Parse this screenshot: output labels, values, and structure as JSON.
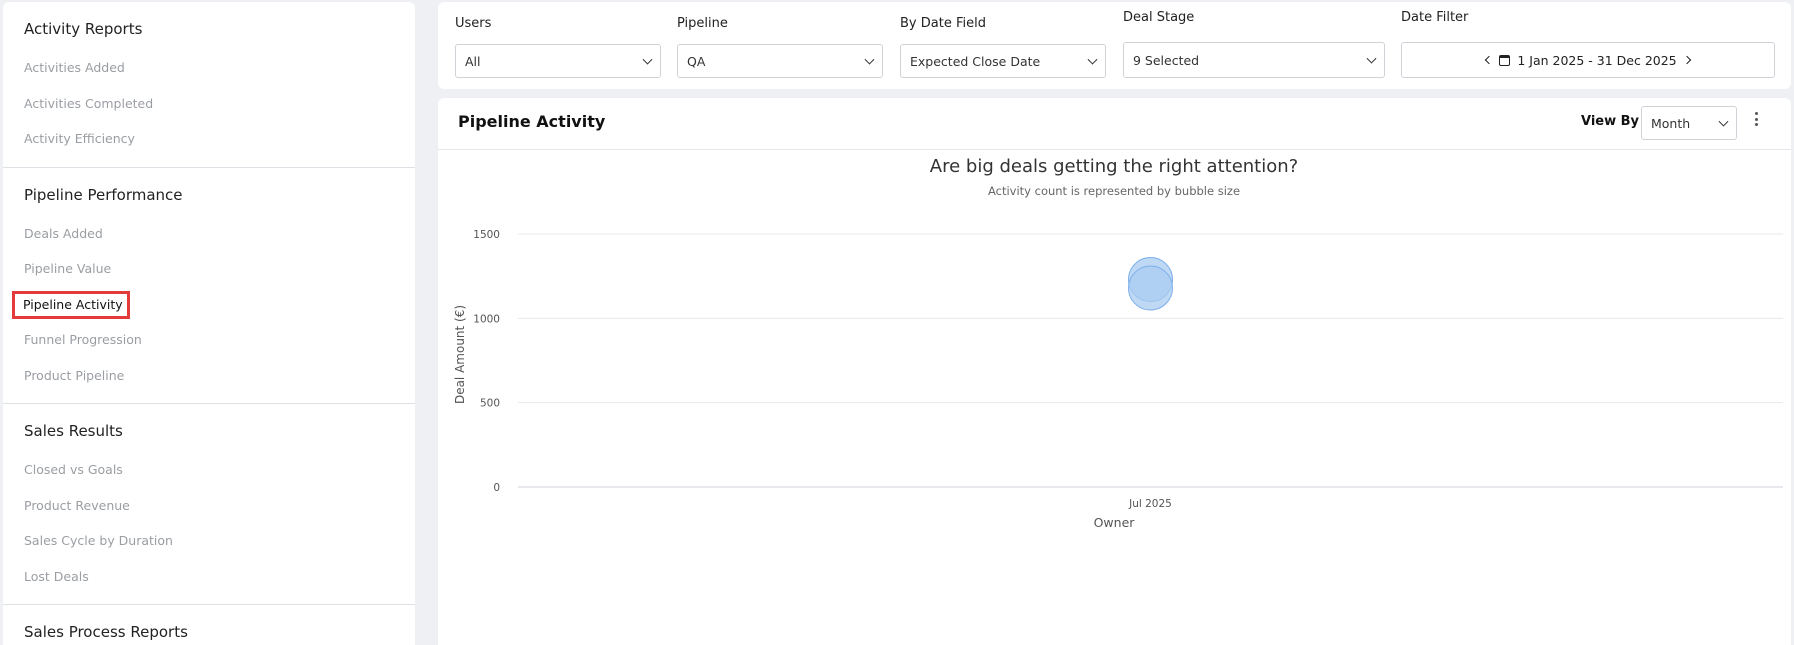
{
  "sidebar": {
    "sections": [
      {
        "title": "Activity Reports",
        "items": [
          "Activities Added",
          "Activities Completed",
          "Activity Efficiency"
        ]
      },
      {
        "title": "Pipeline Performance",
        "items": [
          "Deals Added",
          "Pipeline Value",
          "Pipeline Activity",
          "Funnel Progression",
          "Product Pipeline"
        ]
      },
      {
        "title": "Sales Results",
        "items": [
          "Closed vs Goals",
          "Product Revenue",
          "Sales Cycle by Duration",
          "Lost Deals"
        ]
      },
      {
        "title": "Sales Process Reports",
        "items": []
      }
    ],
    "active_item": "Pipeline Activity"
  },
  "filters": {
    "users": {
      "label": "Users",
      "value": "All"
    },
    "pipeline": {
      "label": "Pipeline",
      "value": "QA"
    },
    "date_field": {
      "label": "By Date Field",
      "value": "Expected Close Date"
    },
    "deal_stage": {
      "label": "Deal Stage",
      "value": "9 Selected"
    },
    "date_filter": {
      "label": "Date Filter",
      "value": "1 Jan 2025 - 31 Dec 2025"
    }
  },
  "panel": {
    "title": "Pipeline Activity",
    "view_by_label": "View By",
    "view_by_value": "Month"
  },
  "chart_data": {
    "type": "scatter",
    "title": "Are big deals getting the right attention?",
    "subtitle": "Activity count is represented by bubble size",
    "xlabel": "Owner",
    "ylabel": "Deal Amount (€)",
    "categories": [
      "Jul 2025"
    ],
    "y_ticks": [
      0,
      500,
      1000,
      1500
    ],
    "ylim": [
      0,
      1500
    ],
    "grid": true,
    "series": [
      {
        "points": [
          {
            "x": "Jul 2025",
            "y": 1230
          },
          {
            "x": "Jul 2025",
            "y": 1180
          }
        ]
      }
    ],
    "colors": {
      "bubble_fill": "#a9ccf2",
      "bubble_stroke": "#7fb1ea"
    }
  }
}
